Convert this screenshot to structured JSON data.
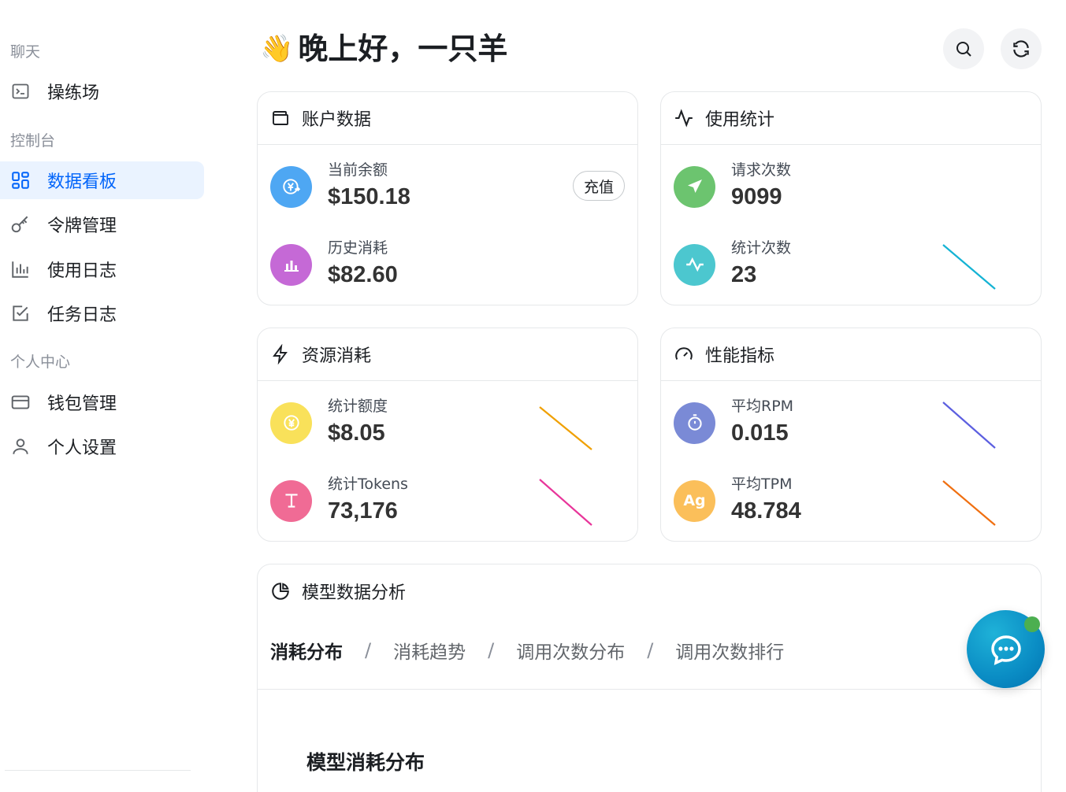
{
  "sidebar": {
    "sections": [
      {
        "label": "聊天"
      },
      {
        "label": "控制台"
      },
      {
        "label": "个人中心"
      }
    ],
    "items": [
      {
        "label": "操练场",
        "icon": "terminal-icon",
        "active": false
      },
      {
        "label": "数据看板",
        "icon": "dashboard-grid-icon",
        "active": true
      },
      {
        "label": "令牌管理",
        "icon": "key-icon",
        "active": false
      },
      {
        "label": "使用日志",
        "icon": "bar-chart-icon",
        "active": false
      },
      {
        "label": "任务日志",
        "icon": "checkbox-icon",
        "active": false
      },
      {
        "label": "钱包管理",
        "icon": "wallet-card-icon",
        "active": false
      },
      {
        "label": "个人设置",
        "icon": "user-icon",
        "active": false
      }
    ]
  },
  "header": {
    "wave": "👋",
    "greeting": "晚上好，一只羊",
    "search_icon": "search-icon",
    "refresh_icon": "refresh-icon"
  },
  "cards": {
    "account": {
      "title": "账户数据",
      "recharge_label": "充值",
      "balance": {
        "label": "当前余额",
        "value": "$150.18",
        "color": "#4ea7f3"
      },
      "history": {
        "label": "历史消耗",
        "value": "$82.60",
        "color": "#c569d6"
      }
    },
    "usage": {
      "title": "使用统计",
      "requests": {
        "label": "请求次数",
        "value": "9099",
        "color": "#6cc46f"
      },
      "stat_count": {
        "label": "统计次数",
        "value": "23",
        "color": "#4cc7cf",
        "spark_color": "#14b3d4"
      }
    },
    "resource": {
      "title": "资源消耗",
      "quota": {
        "label": "统计额度",
        "value": "$8.05",
        "color": "#f9e15a",
        "spark_color": "#f0a000"
      },
      "tokens": {
        "label": "统计Tokens",
        "value": "73,176",
        "color": "#f06b95",
        "spark_color": "#e8359a"
      }
    },
    "performance": {
      "title": "性能指标",
      "rpm": {
        "label": "平均RPM",
        "value": "0.015",
        "color": "#7a8ad6",
        "spark_color": "#5c5fe0"
      },
      "tpm": {
        "label": "平均TPM",
        "value": "48.784",
        "color": "#fbbf5a",
        "spark_color": "#f06f10",
        "badge_text": "Ag"
      }
    }
  },
  "analysis": {
    "title": "模型数据分析",
    "tabs": [
      {
        "label": "消耗分布",
        "active": true
      },
      {
        "label": "消耗趋势",
        "active": false
      },
      {
        "label": "调用次数分布",
        "active": false
      },
      {
        "label": "调用次数排行",
        "active": false
      }
    ],
    "separator": "/",
    "chart_title": "模型消耗分布"
  },
  "fab": {
    "icon": "chat-bubble-icon"
  }
}
